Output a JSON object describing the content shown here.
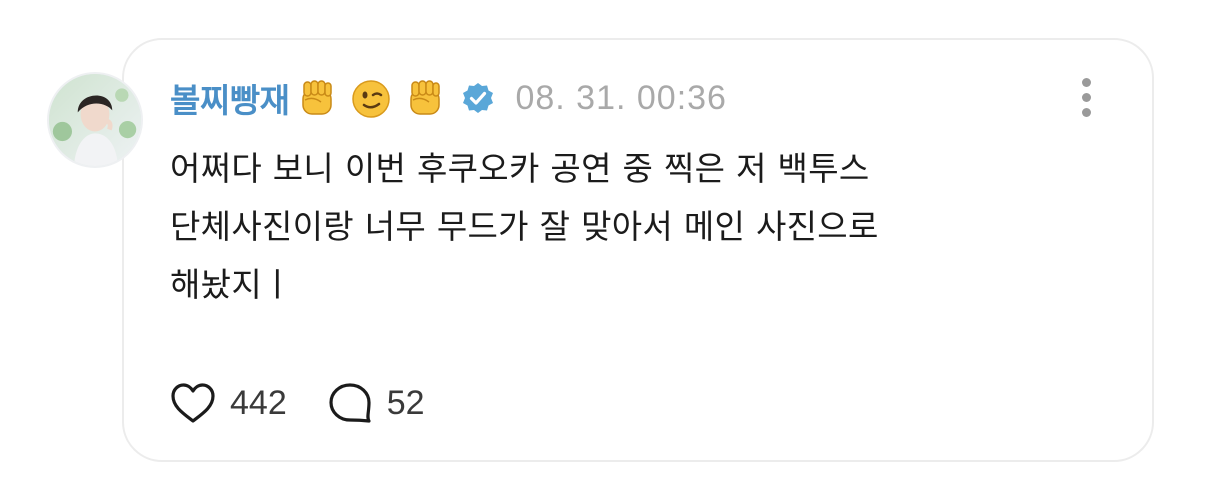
{
  "post": {
    "author": "볼찌빵재",
    "emojis": [
      "fist-emoji",
      "wink-emoji",
      "fist-emoji"
    ],
    "verified_icon": "verified-badge-icon",
    "timestamp": "08. 31. 00:36",
    "text_lines": [
      "어쩌다 보니 이번 후쿠오카 공연 중 찍은 저 백투스",
      "단체사진이랑 너무 무드가 잘 맞아서 메인 사진으로",
      "해놨지ㅣ"
    ],
    "likes": "442",
    "comments": "52"
  },
  "icons": {
    "more": "more-vertical-icon",
    "like": "heart-icon",
    "comment": "comment-bubble-icon"
  },
  "colors": {
    "author": "#4a8fc7",
    "verified": "#5aa7d8",
    "timestamp": "#a9a9a9",
    "text": "#1b1b1b",
    "border": "#ececec"
  }
}
